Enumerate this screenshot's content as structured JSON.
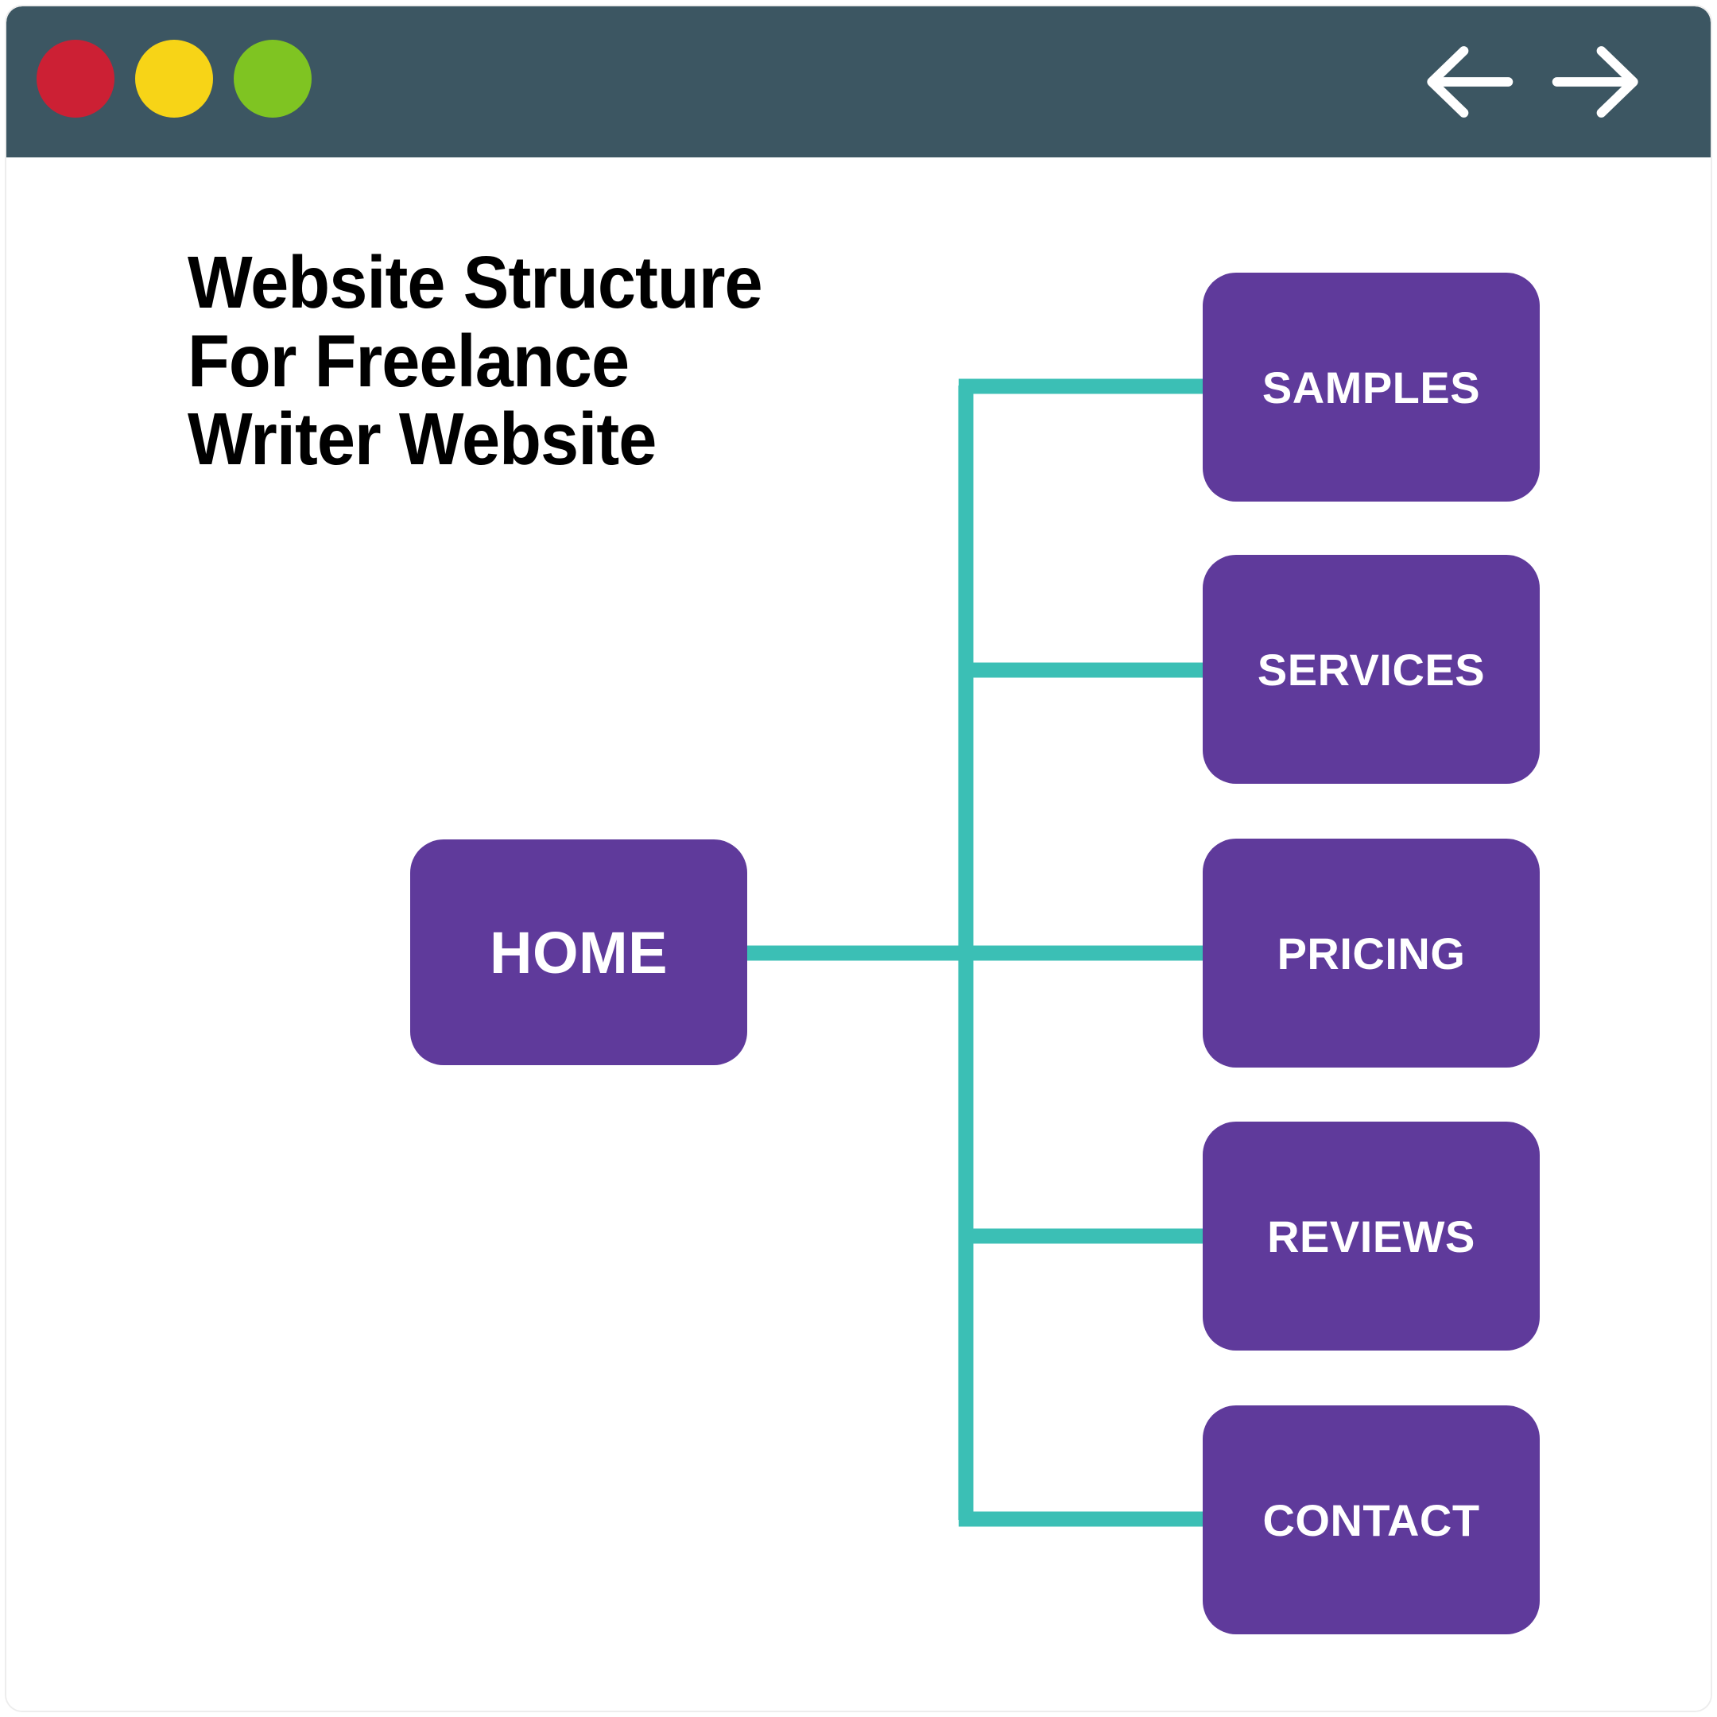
{
  "window": {
    "titlebar": {
      "dots": [
        {
          "name": "close",
          "color": "#cc2034"
        },
        {
          "name": "minimize",
          "color": "#f7d417"
        },
        {
          "name": "maximize",
          "color": "#7fc422"
        }
      ],
      "back_icon": "arrow-left-icon",
      "forward_icon": "arrow-right-icon"
    }
  },
  "diagram": {
    "title": "Website Structure For Freelance Writer Website",
    "colors": {
      "node_fill": "#5f3a9b",
      "node_text": "#ffffff",
      "connector": "#3bbfb5",
      "titlebar": "#3c5662",
      "canvas": "#ffffff"
    },
    "root": {
      "id": "home",
      "label": "HOME"
    },
    "children": [
      {
        "id": "samples",
        "label": "SAMPLES"
      },
      {
        "id": "services",
        "label": "SERVICES"
      },
      {
        "id": "pricing",
        "label": "PRICING"
      },
      {
        "id": "reviews",
        "label": "REVIEWS"
      },
      {
        "id": "contact",
        "label": "CONTACT"
      }
    ]
  }
}
